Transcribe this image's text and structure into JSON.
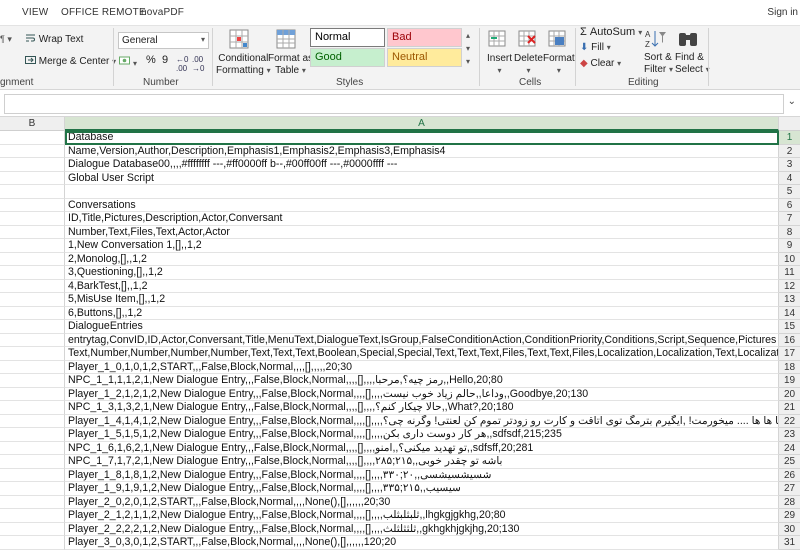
{
  "menu": {
    "items": [
      "VIEW",
      "OFFICE REMOTE",
      "novaPDF"
    ],
    "sign_in": "Sign in"
  },
  "ribbon": {
    "alignment": {
      "wrap_text": "Wrap Text",
      "merge_center": "Merge & Center",
      "group_label": "gnment"
    },
    "number": {
      "format_value": "General",
      "percent_symbol": "%",
      "comma_symbol": "9",
      "group_label": "Number"
    },
    "styles": {
      "conditional_formatting_line1": "Conditional",
      "conditional_formatting_line2": "Formatting",
      "format_as_table_line1": "Format as",
      "format_as_table_line2": "Table",
      "cells": [
        {
          "label": "Normal",
          "bg": "#ffffff",
          "fg": "#000000"
        },
        {
          "label": "Bad",
          "bg": "#ffc7ce",
          "fg": "#9c0006"
        },
        {
          "label": "Good",
          "bg": "#c6efce",
          "fg": "#006100"
        },
        {
          "label": "Neutral",
          "bg": "#ffeb9c",
          "fg": "#9c5700"
        }
      ],
      "group_label": "Styles"
    },
    "cells_group": {
      "insert": "Insert",
      "delete": "Delete",
      "format": "Format",
      "group_label": "Cells"
    },
    "editing": {
      "autosum": "AutoSum",
      "fill": "Fill",
      "clear": "Clear",
      "sort_filter_line1": "Sort &",
      "sort_filter_line2": "Filter",
      "find_select_line1": "Find &",
      "find_select_line2": "Select",
      "group_label": "Editing"
    }
  },
  "grid": {
    "columns": [
      "B",
      "A"
    ],
    "rows": [
      {
        "n": "1",
        "text": "Database"
      },
      {
        "n": "2",
        "text": "Name,Version,Author,Description,Emphasis1,Emphasis2,Emphasis3,Emphasis4"
      },
      {
        "n": "3",
        "text": "Dialogue Database00,,,,#ffffffff ---,#ff0000ff b--,#00ff00ff ---,#0000ffff ---"
      },
      {
        "n": "4",
        "text": "Global User Script"
      },
      {
        "n": "5",
        "text": ""
      },
      {
        "n": "6",
        "text": "Conversations"
      },
      {
        "n": "7",
        "text": "ID,Title,Pictures,Description,Actor,Conversant"
      },
      {
        "n": "8",
        "text": "Number,Text,Files,Text,Actor,Actor"
      },
      {
        "n": "9",
        "text": "1,New Conversation 1,[],,1,2"
      },
      {
        "n": "10",
        "text": "2,Monolog,[],,1,2"
      },
      {
        "n": "11",
        "text": "3,Questioning,[],,1,2"
      },
      {
        "n": "12",
        "text": "4,BarkTest,[],,1,2"
      },
      {
        "n": "13",
        "text": "5,MisUse Item,[],,1,2"
      },
      {
        "n": "14",
        "text": "6,Buttons,[],,1,2"
      },
      {
        "n": "15",
        "text": "DialogueEntries"
      },
      {
        "n": "16",
        "text": "entrytag,ConvID,ID,Actor,Conversant,Title,MenuText,DialogueText,IsGroup,FalseConditionAction,ConditionPriority,Conditions,Script,Sequence,Pictures"
      },
      {
        "n": "17",
        "text": "Text,Number,Number,Number,Number,Text,Text,Text,Boolean,Special,Special,Text,Text,Text,Files,Text,Text,Files,Localization,Localization,Text,Localization"
      },
      {
        "n": "18",
        "text": "Player_1_0,1,0,1,2,START,,,False,Block,Normal,,,,[],,,,,20;30"
      },
      {
        "n": "19",
        "text": "NPC_1_1,1,1,2,1,New Dialogue Entry,,,False,Block,Normal,,,,[],,,,رمز چیه؟,مرحبا,,Hello,20;80"
      },
      {
        "n": "20",
        "text": "Player_1_2,1,2,1,2,New Dialogue Entry,,,False,Block,Normal,,,,[],,,,وداعا,,حالم زیاد خوب نیست,,Goodbye,20;130"
      },
      {
        "n": "21",
        "text": "NPC_1_3,1,3,2,1,New Dialogue Entry,,,False,Block,Normal,,,,[],,,,حالا چیکار کنم؟,,What?,20;180"
      },
      {
        "n": "22",
        "text": "Player_1_4,1,4,1,2,New Dialogue Entry,,,False,Block,Normal,,,,[],,,,ها ها ها .... میخورمت! ,ایگیرم بترمگ توی اتاقت و کارت رو زودتر تموم کن لعنتی! وگرنه چی؟,,Hot!,20;230"
      },
      {
        "n": "23",
        "text": "Player_1_5,1,5,1,2,New Dialogue Entry,,,False,Block,Normal,,,,[],,,,هر کار دوست داری بکن,,sdfsdf,215;235"
      },
      {
        "n": "24",
        "text": "NPC_1_6,1,6,2,1,New Dialogue Entry,,,False,Block,Normal,,,,[],,,,تو تهدید میکنی؟,,امنو,,sdfsff,20;281"
      },
      {
        "n": "25",
        "text": "NPC_1_7,1,7,2,1,New Dialogue Entry,,,False,Block,Normal,,,,[],,,,۲۸۵;۲۱۵,,باشه تو چقدر خوبی"
      },
      {
        "n": "26",
        "text": "Player_1_8,1,8,1,2,New Dialogue Entry,,,False,Block,Normal,,,,[],,,,۳۳۰;۲۰,,شسیشسیشسی"
      },
      {
        "n": "27",
        "text": "Player_1_9,1,9,1,2,New Dialogue Entry,,,False,Block,Normal,,,,[],,,,۳۳۵;۲۱۵,,سیسیب"
      },
      {
        "n": "28",
        "text": "Player_2_0,2,0,1,2,START,,,False,Block,Normal,,,,None(),[],,,,,,20;30"
      },
      {
        "n": "29",
        "text": "Player_2_1,2,1,1,2,New Dialogue Entry,,,False,Block,Normal,,,,[],,,,ثلبثلبثلب,,lhgkgjgkhg,20;80"
      },
      {
        "n": "30",
        "text": "Player_2_2,2,2,1,2,New Dialogue Entry,,,False,Block,Normal,,,,[],,,,ثلثثلثلث,,gkhgkhjgkjhg,20;130"
      },
      {
        "n": "31",
        "text": "Player_3_0,3,0,1,2,START,,,False,Block,Normal,,,,None(),[],,,,,,120;20"
      }
    ]
  }
}
